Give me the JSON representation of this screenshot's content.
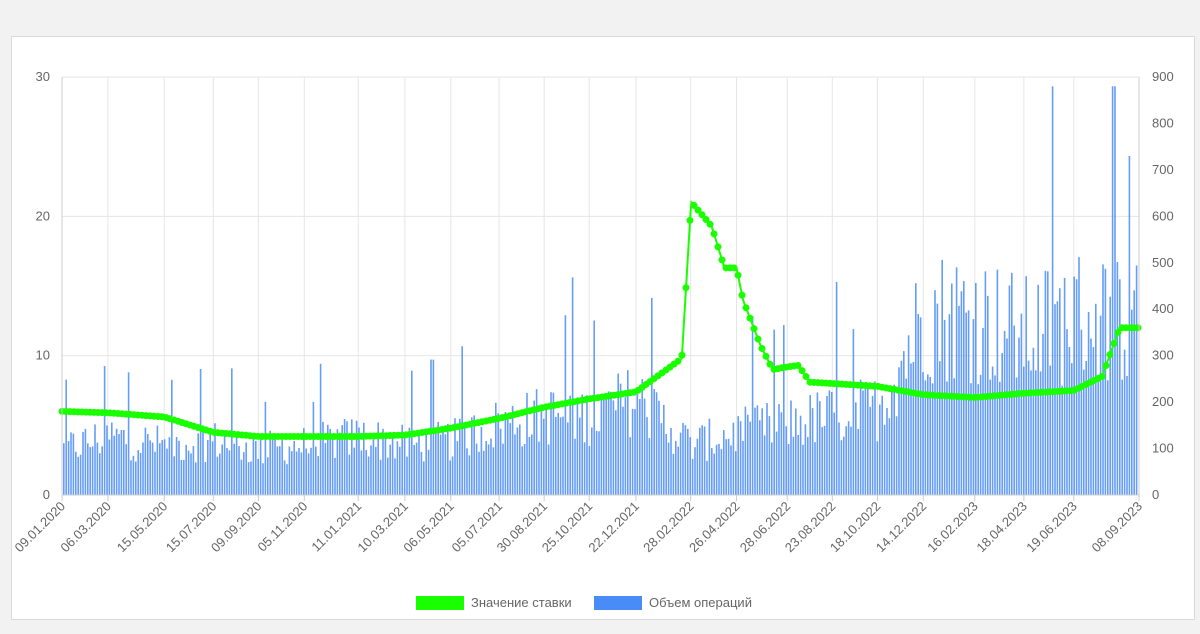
{
  "chart_data": {
    "type": "bar+line",
    "x_tick_labels": [
      "09.01.2020",
      "06.03.2020",
      "15.05.2020",
      "15.07.2020",
      "09.09.2020",
      "05.11.2020",
      "11.01.2021",
      "10.03.2021",
      "06.05.2021",
      "05.07.2021",
      "30.08.2021",
      "25.10.2021",
      "22.12.2021",
      "28.02.2022",
      "26.04.2022",
      "28.06.2022",
      "23.08.2022",
      "18.10.2022",
      "14.12.2022",
      "16.02.2023",
      "18.04.2023",
      "19.06.2023",
      "08.09.2023"
    ],
    "y_left": {
      "ticks": [
        "0",
        "10",
        "20",
        "30"
      ],
      "range": [
        0,
        30
      ]
    },
    "y_right": {
      "ticks": [
        "0",
        "100",
        "200",
        "300",
        "400",
        "500",
        "600",
        "700",
        "800",
        "900"
      ],
      "range": [
        0,
        900
      ]
    },
    "grid": true,
    "legend_position": "bottom",
    "series": [
      {
        "name": "Значение ставки",
        "type": "line",
        "axis": "left",
        "color": "#1aff00",
        "values": [
          {
            "x": "09.01.2020",
            "y": 6.0
          },
          {
            "x": "06.03.2020",
            "y": 5.9
          },
          {
            "x": "15.05.2020",
            "y": 5.6
          },
          {
            "x": "15.07.2020",
            "y": 4.5
          },
          {
            "x": "09.09.2020",
            "y": 4.2
          },
          {
            "x": "05.11.2020",
            "y": 4.2
          },
          {
            "x": "11.01.2021",
            "y": 4.2
          },
          {
            "x": "10.03.2021",
            "y": 4.3
          },
          {
            "x": "06.05.2021",
            "y": 4.8
          },
          {
            "x": "05.07.2021",
            "y": 5.5
          },
          {
            "x": "30.08.2021",
            "y": 6.3
          },
          {
            "x": "25.10.2021",
            "y": 6.9
          },
          {
            "x": "22.12.2021",
            "y": 7.4
          },
          {
            "x": "17.02.2022",
            "y": 9.8
          },
          {
            "x": "28.02.2022",
            "y": 20.5
          },
          {
            "x": "01.03.2022",
            "y": 21.0
          },
          {
            "x": "26.03.2022",
            "y": 19.3
          },
          {
            "x": "11.04.2022",
            "y": 16.3
          },
          {
            "x": "26.04.2022",
            "y": 16.3
          },
          {
            "x": "04.05.2022",
            "y": 14.0
          },
          {
            "x": "26.05.2022",
            "y": 10.7
          },
          {
            "x": "10.06.2022",
            "y": 9.0
          },
          {
            "x": "28.06.2022",
            "y": 9.2
          },
          {
            "x": "12.07.2022",
            "y": 9.3
          },
          {
            "x": "26.07.2022",
            "y": 8.1
          },
          {
            "x": "23.08.2022",
            "y": 8.0
          },
          {
            "x": "18.10.2022",
            "y": 7.8
          },
          {
            "x": "14.12.2022",
            "y": 7.2
          },
          {
            "x": "16.02.2023",
            "y": 7.0
          },
          {
            "x": "18.04.2023",
            "y": 7.3
          },
          {
            "x": "19.06.2023",
            "y": 7.5
          },
          {
            "x": "24.07.2023",
            "y": 8.5
          },
          {
            "x": "15.08.2023",
            "y": 12.0
          },
          {
            "x": "08.09.2023",
            "y": 12.0
          }
        ]
      },
      {
        "name": "Объем операций",
        "type": "bar",
        "axis": "right",
        "color": "#4a8cf7",
        "values": [
          {
            "x": "09.01.2020",
            "y": 110
          },
          {
            "x": "06.03.2020",
            "y": 140
          },
          {
            "x": "15.05.2020",
            "y": 120
          },
          {
            "x": "15.07.2020",
            "y": 130
          },
          {
            "x": "09.09.2020",
            "y": 110
          },
          {
            "x": "05.11.2020",
            "y": 120
          },
          {
            "x": "11.01.2021",
            "y": 140
          },
          {
            "x": "10.03.2021",
            "y": 120
          },
          {
            "x": "06.05.2021",
            "y": 130
          },
          {
            "x": "05.07.2021",
            "y": 170
          },
          {
            "x": "30.08.2021",
            "y": 190
          },
          {
            "x": "25.10.2021",
            "y": 190
          },
          {
            "x": "22.12.2021",
            "y": 230
          },
          {
            "x": "28.02.2022",
            "y": 120
          },
          {
            "x": "26.04.2022",
            "y": 150
          },
          {
            "x": "28.06.2022",
            "y": 170
          },
          {
            "x": "23.08.2022",
            "y": 190
          },
          {
            "x": "18.10.2022",
            "y": 210
          },
          {
            "x": "14.12.2022",
            "y": 430
          },
          {
            "x": "16.02.2023",
            "y": 430
          },
          {
            "x": "18.04.2023",
            "y": 380
          },
          {
            "x": "19.06.2023",
            "y": 430
          },
          {
            "x": "08.09.2023",
            "y": 420
          }
        ]
      }
    ]
  }
}
